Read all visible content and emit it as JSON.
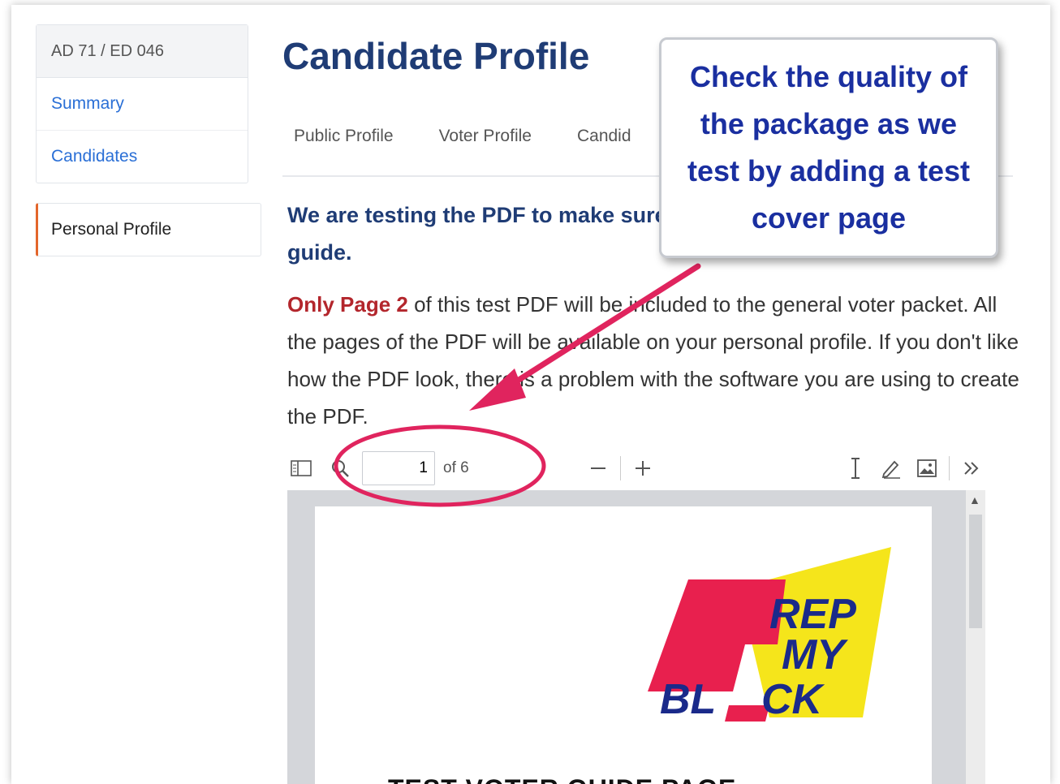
{
  "sidebar": {
    "district": "AD 71 / ED 046",
    "links": [
      "Summary",
      "Candidates"
    ],
    "active_item": "Personal Profile",
    "active_color": "#e3662b"
  },
  "main": {
    "title": "Candidate Profile",
    "tabs": [
      "Public Profile",
      "Voter Profile",
      "Candid"
    ],
    "lead_text": "We are testing the PDF to make sure it will be added to the voter guide.",
    "body": {
      "highlight": "Only Page 2",
      "rest": " of this test PDF will be included to the general voter packet. All the pages of the PDF will be available on your personal profile. If you don't like how the PDF look, there is a problem with the software you are using to create the PDF."
    }
  },
  "pdf_viewer": {
    "current_page": "1",
    "page_count_label": "of 6",
    "icons": [
      "sidebar-toggle-icon",
      "search-icon",
      "zoom-out-icon",
      "zoom-in-icon",
      "text-cursor-icon",
      "draw-icon",
      "image-icon",
      "more-tools-icon"
    ],
    "page_heading": "TEST VOTER GUIDE PAGE",
    "logo_lines": [
      "REP",
      "MY",
      "BL",
      "CK"
    ]
  },
  "callout": {
    "text": "Check the quality of the package as we test by adding a test cover page",
    "text_color": "#1a2fa0"
  },
  "annotation_color": "#e0245e"
}
